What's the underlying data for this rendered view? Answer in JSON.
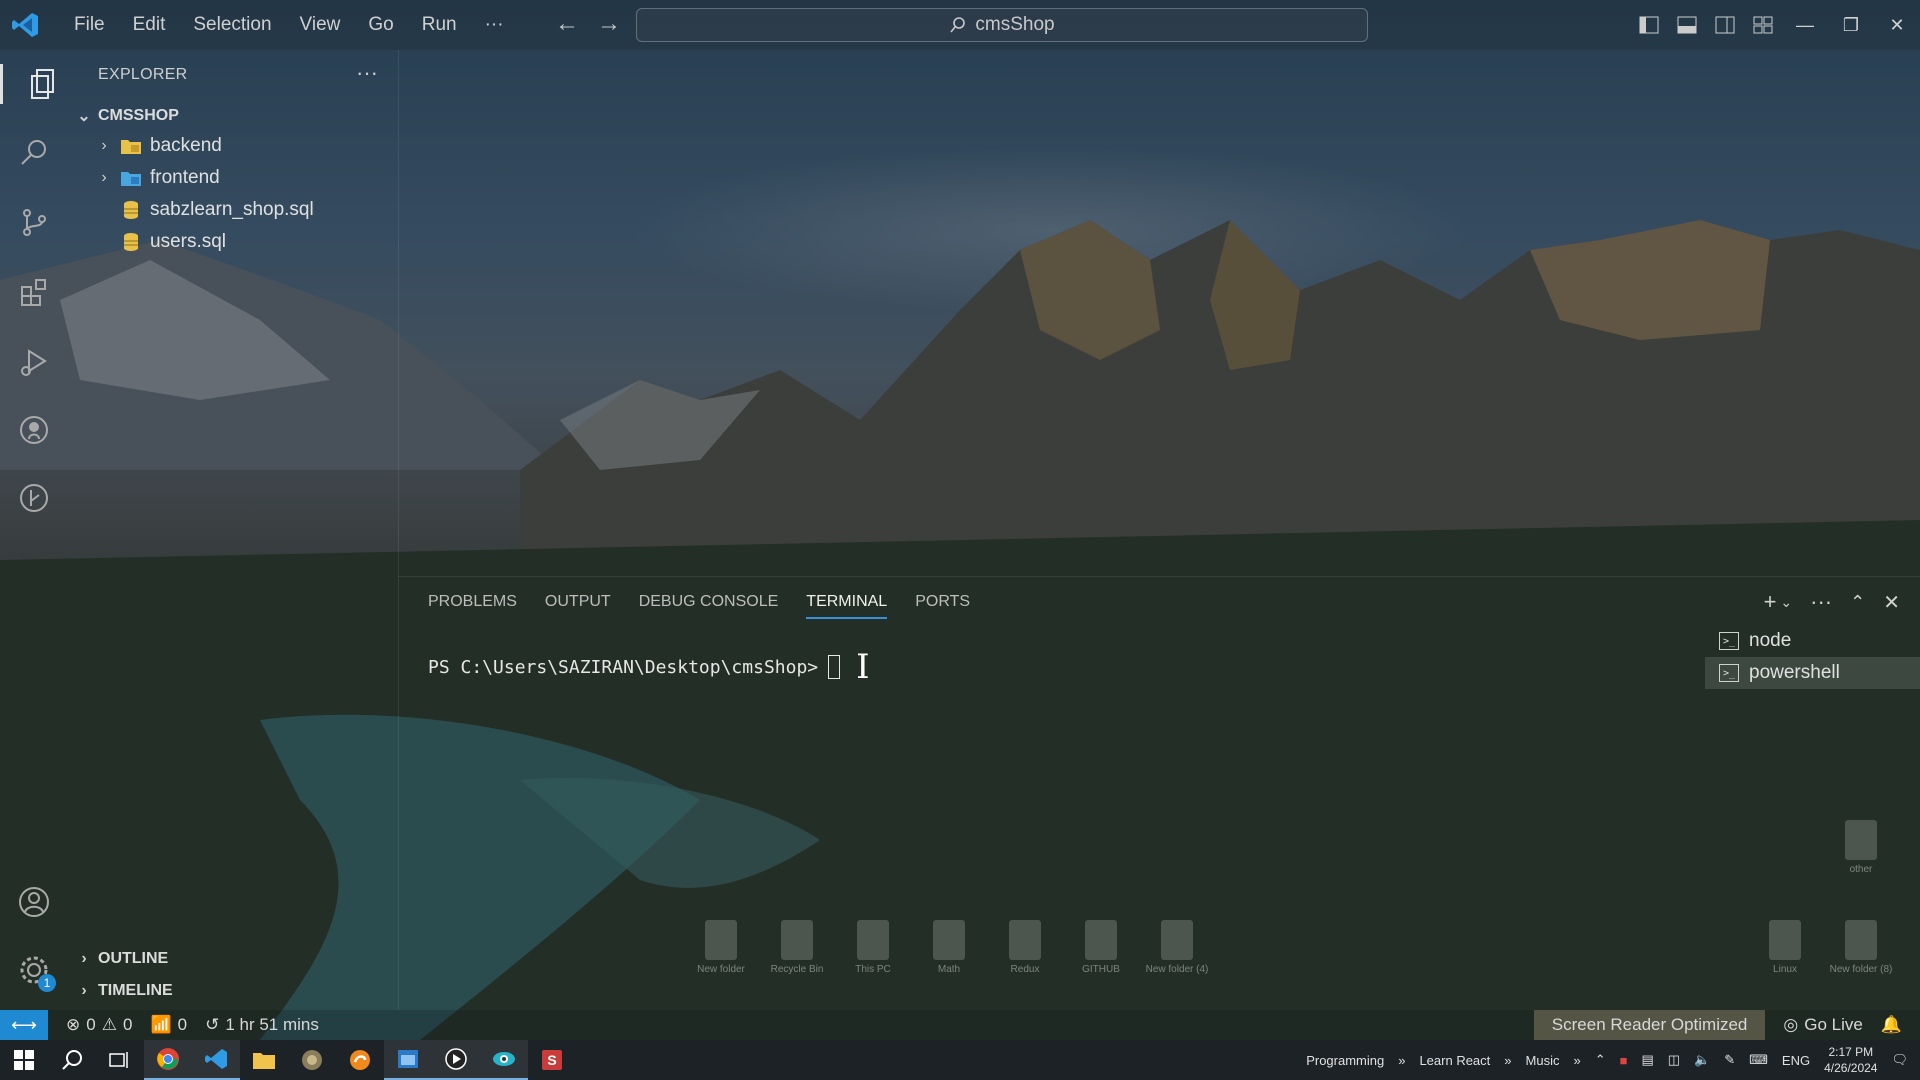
{
  "menu": [
    "File",
    "Edit",
    "Selection",
    "View",
    "Go",
    "Run",
    "···"
  ],
  "command_center": {
    "text": "cmsShop"
  },
  "sidebar": {
    "title": "EXPLORER",
    "more": "···",
    "root": "CMSSHOP",
    "items": [
      {
        "label": "backend"
      },
      {
        "label": "frontend"
      },
      {
        "label": "sabzlearn_shop.sql"
      },
      {
        "label": "users.sql"
      }
    ],
    "outline": "OUTLINE",
    "timeline": "TIMELINE"
  },
  "activity": {
    "badge": "1"
  },
  "panel": {
    "tabs": [
      "PROBLEMS",
      "OUTPUT",
      "DEBUG CONSOLE",
      "TERMINAL",
      "PORTS"
    ],
    "active_tab": "TERMINAL",
    "prompt": "PS C:\\Users\\SAZIRAN\\Desktop\\cmsShop>",
    "terminals": [
      "node",
      "powershell"
    ]
  },
  "desktop_icons": [
    "New folder",
    "Recycle Bin",
    "This PC",
    "Math",
    "Redux",
    "GITHUB",
    "New folder (4)",
    "Linux",
    "New folder (8)",
    "other"
  ],
  "statusbar": {
    "errors": "0",
    "warnings": "0",
    "ports": "0",
    "time": "1 hr 51 mins",
    "screen_reader": "Screen Reader Optimized",
    "go_live": "Go Live"
  },
  "taskbar": {
    "toolbars": [
      "Programming",
      "Learn React",
      "Music"
    ],
    "lang": "ENG",
    "time": "2:17 PM",
    "date": "4/26/2024"
  },
  "colors": {
    "accent": "#1f8ad2",
    "taskbar": "#1d2226"
  }
}
